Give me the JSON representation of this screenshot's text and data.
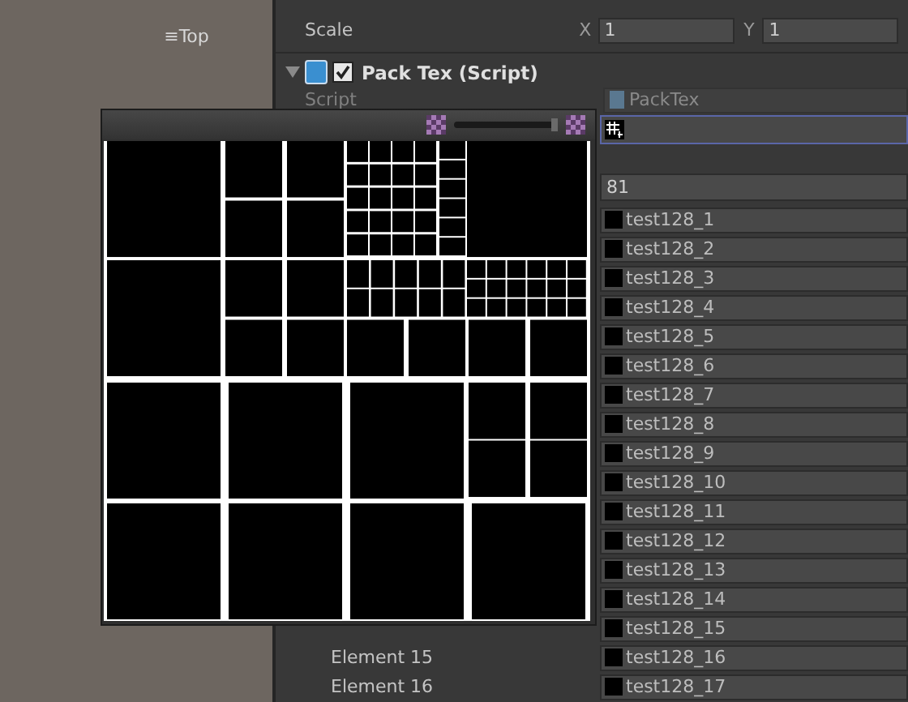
{
  "scene_view": {
    "orientation_label": "≡Top"
  },
  "transform": [
    {
      "label": "Scale",
      "x_axis": "X",
      "x_value": "1",
      "y_axis": "Y",
      "y_value": "1"
    }
  ],
  "component": {
    "title": "Pack Tex (Script)",
    "expanded": true,
    "enabled": true,
    "script_label": "Script",
    "script_value": "PackTex"
  },
  "texture_field": {
    "focused": true
  },
  "preview": {
    "zoom": {
      "level": 1
    }
  },
  "count": "81",
  "elements": [
    {
      "value": "test128_1"
    },
    {
      "value": "test128_2"
    },
    {
      "value": "test128_3"
    },
    {
      "value": "test128_4"
    },
    {
      "value": "test128_5"
    },
    {
      "value": "test128_6"
    },
    {
      "value": "test128_7"
    },
    {
      "value": "test128_8"
    },
    {
      "value": "test128_9"
    },
    {
      "value": "test128_10"
    },
    {
      "value": "test128_11"
    },
    {
      "value": "test128_12"
    },
    {
      "value": "test128_13"
    },
    {
      "value": "test128_14"
    },
    {
      "value": "test128_15"
    },
    {
      "label": "Element 15",
      "value": "test128_16"
    },
    {
      "label": "Element 16",
      "value": "test128_17"
    }
  ]
}
